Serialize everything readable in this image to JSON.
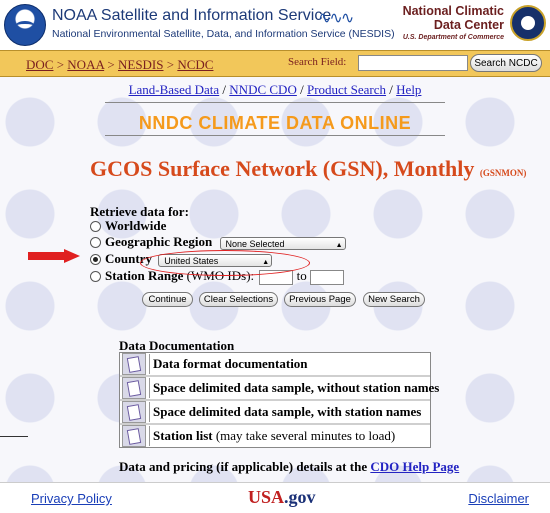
{
  "header": {
    "org_title": "NOAA Satellite and Information Service",
    "org_subtitle": "National Environmental Satellite, Data, and Information Service (NESDIS)",
    "ncdc_line1": "National Climatic",
    "ncdc_line2": "Data Center",
    "dept": "U.S. Department of Commerce"
  },
  "breadcrumb": {
    "doc": "DOC",
    "noaa": "NOAA",
    "nesdis": "NESDIS",
    "ncdc": "NCDC",
    "sep": " > "
  },
  "search": {
    "label": "Search Field:",
    "value": "",
    "button": "Search NCDC"
  },
  "links": {
    "land": "Land-Based Data",
    "cdo": "NNDC CDO",
    "product": "Product Search",
    "help": "Help",
    "sep": " / "
  },
  "banner": "NNDC CLIMATE DATA ONLINE",
  "page_title": {
    "main": "GCOS Surface Network (GSN), Monthly",
    "code": "(GSNMON)"
  },
  "form": {
    "retrieve_label": "Retrieve data for:",
    "worldwide": "Worldwide",
    "region_label": "Geographic Region",
    "region_value": "None Selected",
    "country_label": "Country",
    "country_value": "United States",
    "station_label": "Station Range",
    "station_hint": "(WMO IDs):",
    "to_label": "to",
    "selected": "country"
  },
  "buttons": {
    "continue": "Continue",
    "clear": "Clear Selections",
    "previous": "Previous Page",
    "new": "New Search"
  },
  "documentation": {
    "heading": "Data Documentation",
    "items": [
      {
        "label": "Data format documentation",
        "note": ""
      },
      {
        "label": "Space delimited data sample, without station names",
        "note": ""
      },
      {
        "label": "Space delimited data sample, with station names",
        "note": ""
      },
      {
        "label": "Station list",
        "note": " (may take several minutes to load)"
      }
    ]
  },
  "pricing": {
    "text": "Data and pricing (if applicable) details at the ",
    "link": "CDO Help Page"
  },
  "footer": {
    "privacy": "Privacy Policy",
    "usa": "USA",
    "gov": ".gov",
    "disclaimer": "Disclaimer"
  },
  "colors": {
    "banner": "#f59a1c",
    "title": "#d64a1c",
    "navbar": "#f2c75a",
    "link": "#2323c2",
    "annotation": "#e02020"
  }
}
